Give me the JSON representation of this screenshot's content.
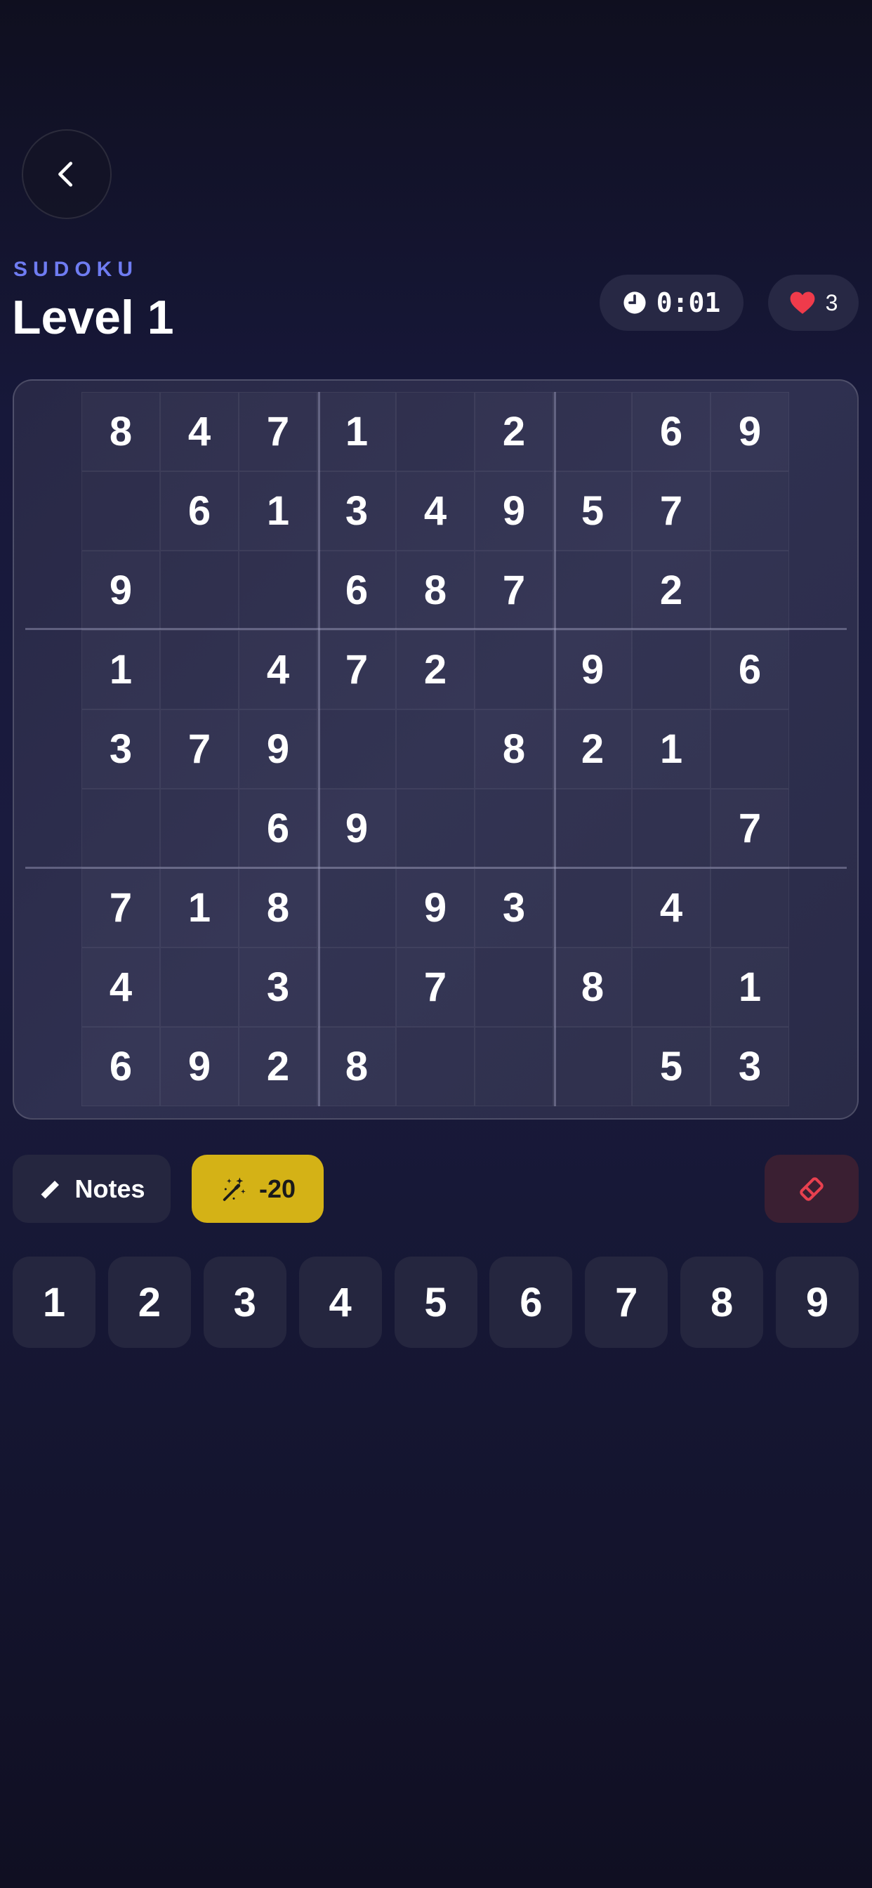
{
  "header": {
    "game_label": "SUDOKU",
    "level_title": "Level 1",
    "timer": "0:01",
    "lives": "3"
  },
  "board": {
    "rows": [
      [
        "8",
        "4",
        "7",
        "1",
        "",
        "2",
        "",
        "6",
        "9"
      ],
      [
        "",
        "6",
        "1",
        "3",
        "4",
        "9",
        "5",
        "7",
        ""
      ],
      [
        "9",
        "",
        "",
        "6",
        "8",
        "7",
        "",
        "2",
        ""
      ],
      [
        "1",
        "",
        "4",
        "7",
        "2",
        "",
        "9",
        "",
        "6"
      ],
      [
        "3",
        "7",
        "9",
        "",
        "",
        "8",
        "2",
        "1",
        ""
      ],
      [
        "",
        "",
        "6",
        "9",
        "",
        "",
        "",
        "",
        "7"
      ],
      [
        "7",
        "1",
        "8",
        "",
        "9",
        "3",
        "",
        "4",
        ""
      ],
      [
        "4",
        "",
        "3",
        "",
        "7",
        "",
        "8",
        "",
        "1"
      ],
      [
        "6",
        "9",
        "2",
        "8",
        "",
        "",
        "",
        "5",
        "3"
      ]
    ]
  },
  "controls": {
    "notes_label": "Notes",
    "hint_label": "-20"
  },
  "numpad": {
    "keys": [
      "1",
      "2",
      "3",
      "4",
      "5",
      "6",
      "7",
      "8",
      "9"
    ]
  },
  "icons": {
    "back": "chevron-left-icon",
    "timer": "clock-icon",
    "lives": "heart-icon",
    "notes": "pencil-icon",
    "hint": "magic-wand-icon",
    "erase": "eraser-icon"
  },
  "colors": {
    "accent": "#6f7cf2",
    "hint": "#d4b216",
    "heart": "#ef3b4b",
    "erase": "#e8404f"
  }
}
